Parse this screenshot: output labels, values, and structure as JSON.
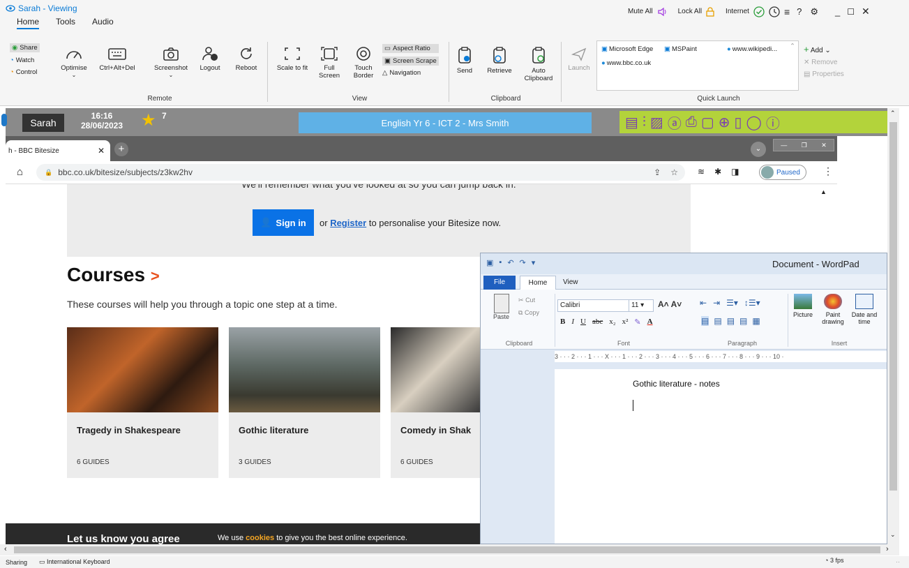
{
  "app": {
    "title": "Sarah - Viewing",
    "tabs": [
      "Home",
      "Tools",
      "Audio"
    ],
    "right_controls": {
      "mute": "Mute All",
      "lock": "Lock All",
      "internet": "Internet",
      "help": "?"
    },
    "side_buttons": [
      "Share",
      "Watch",
      "Control"
    ],
    "remote_buttons": [
      "Optimise",
      "Ctrl+Alt+Del",
      "Screenshot",
      "Logout",
      "Reboot"
    ],
    "remote_group": "Remote",
    "view_buttons": [
      {
        "line1": "Scale to fit",
        "line2": ""
      },
      {
        "line1": "Full",
        "line2": "Screen"
      },
      {
        "line1": "Touch",
        "line2": "Border"
      }
    ],
    "view_small": [
      "Aspect Ratio",
      "Screen Scrape",
      "Navigation"
    ],
    "view_group": "View",
    "clipboard_buttons": [
      {
        "line1": "Send",
        "line2": ""
      },
      {
        "line1": "Retrieve",
        "line2": ""
      },
      {
        "line1": "Auto",
        "line2": "Clipboard"
      }
    ],
    "clipboard_group": "Clipboard",
    "launch": "Launch",
    "quick_launch": [
      "Microsoft Edge",
      "MSPaint",
      "www.wikipedi...",
      "www.bbc.co.uk"
    ],
    "quick_actions": [
      "Add",
      "Remove",
      "Properties"
    ],
    "quick_group": "Quick Launch"
  },
  "student_bar": {
    "name": "Sarah",
    "time": "16:16",
    "date": "28/06/2023",
    "stars": "7",
    "lesson": "English Yr 6 - ICT 2 - Mrs Smith"
  },
  "browser": {
    "tab_title": "h - BBC Bitesize",
    "url": "bbc.co.uk/bitesize/subjects/z3kw2hv",
    "profile": "Paused"
  },
  "page": {
    "banner_text": "We'll remember what you've looked at so you can jump back in.",
    "sign_in": "Sign in",
    "or": "or",
    "register": "Register",
    "personalise": "to personalise your Bitesize now.",
    "courses_title": "Courses",
    "courses_arrow": ">",
    "courses_desc": "These courses will help you through a topic one step at a time.",
    "courses": [
      {
        "title": "Tragedy in Shakespeare",
        "guides": "6 GUIDES"
      },
      {
        "title": "Gothic literature",
        "guides": "3 GUIDES"
      },
      {
        "title": "Comedy in Shak",
        "guides": "6 GUIDES"
      }
    ],
    "cookie_title": "Let us know you agree",
    "cookie_pre": "We use",
    "cookie_link": "cookies",
    "cookie_post": "to give you the best online experience."
  },
  "wordpad": {
    "title": "Document - WordPad",
    "tabs": [
      "File",
      "Home",
      "View"
    ],
    "cut": "Cut",
    "copy": "Copy",
    "paste": "Paste",
    "clipboard_group": "Clipboard",
    "font_name": "Calibri",
    "font_size": "11",
    "font_group": "Font",
    "paragraph_group": "Paragraph",
    "insert_group": "Insert",
    "picture": "Picture",
    "paint_drawing": "Paint drawing",
    "date_time": "Date and time",
    "ruler": "3 · · · 2 · · · 1 · · · X · · · 1 · · · 2 · · · 3 · · · 4 · · · 5 · · · 6 · · · 7 · · · 8 · · · 9 · · · 10 ·",
    "doc_text": "Gothic literature - notes"
  },
  "status": {
    "left": "Sharing",
    "keyboard": "International Keyboard",
    "fps": "3 fps"
  },
  "colors": {
    "accent": "#0a7bd6",
    "bitesize_blue": "#1e78c8",
    "lesson_bar": "#5fb1e6",
    "icon_bar": "#b3d33b",
    "signin": "#0a72e6"
  }
}
